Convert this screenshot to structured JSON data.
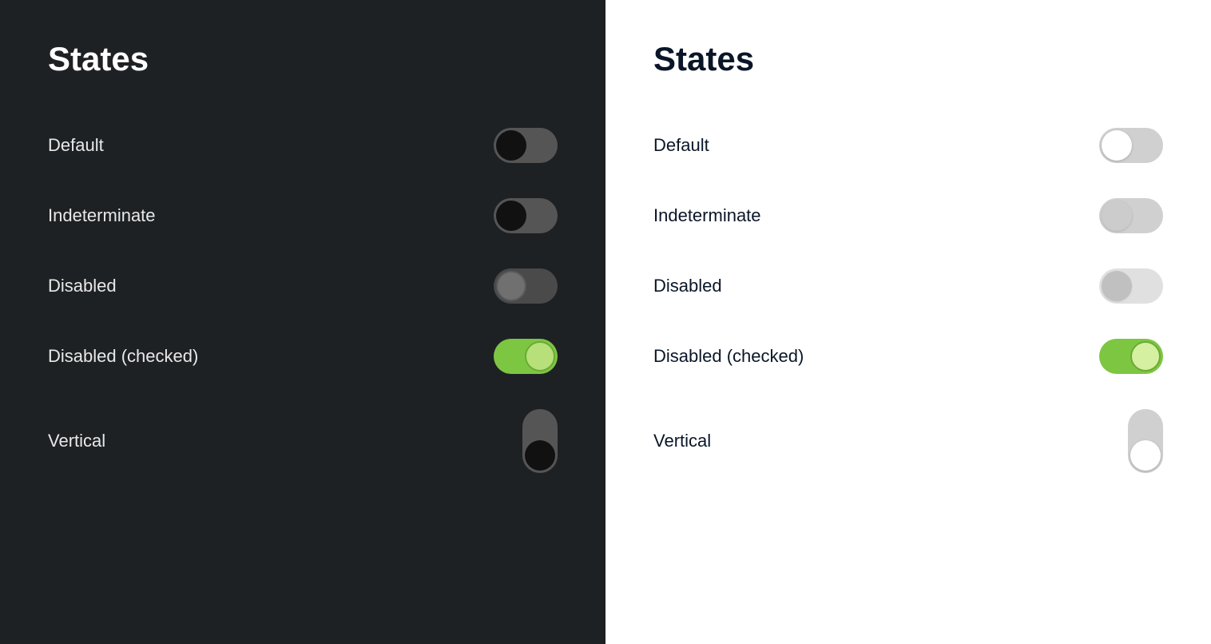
{
  "dark_panel": {
    "title": "States",
    "rows": [
      {
        "id": "default",
        "label": "Default"
      },
      {
        "id": "indeterminate",
        "label": "Indeterminate"
      },
      {
        "id": "disabled",
        "label": "Disabled"
      },
      {
        "id": "disabled-checked",
        "label": "Disabled (checked)"
      },
      {
        "id": "vertical",
        "label": "Vertical"
      }
    ]
  },
  "light_panel": {
    "title": "States",
    "rows": [
      {
        "id": "default",
        "label": "Default"
      },
      {
        "id": "indeterminate",
        "label": "Indeterminate"
      },
      {
        "id": "disabled",
        "label": "Disabled"
      },
      {
        "id": "disabled-checked",
        "label": "Disabled (checked)"
      },
      {
        "id": "vertical",
        "label": "Vertical"
      }
    ]
  },
  "colors": {
    "green": "#7dc642",
    "dark_bg": "#1e2124",
    "light_bg": "#ffffff"
  }
}
